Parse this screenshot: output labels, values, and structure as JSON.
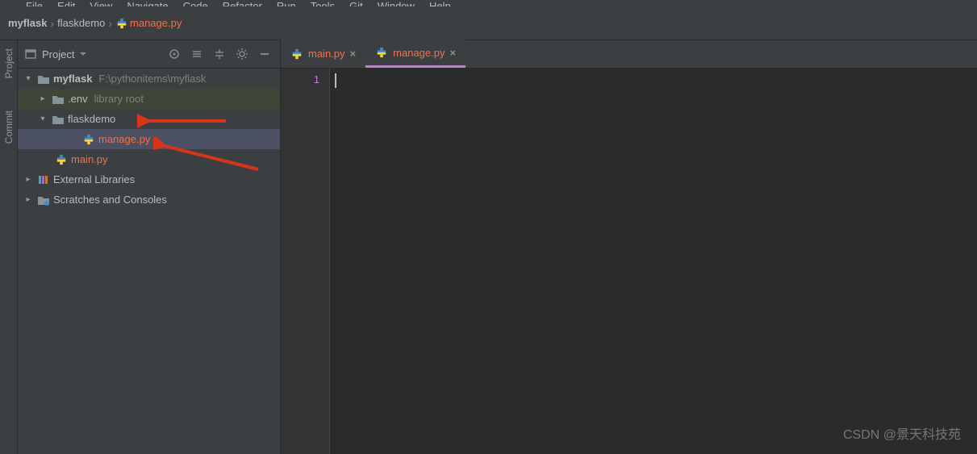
{
  "menu": [
    "File",
    "Edit",
    "View",
    "Navigate",
    "Code",
    "Refactor",
    "Run",
    "Tools",
    "Git",
    "Window",
    "Help"
  ],
  "breadcrumb": {
    "root": "myflask",
    "folder": "flaskdemo",
    "file": "manage.py"
  },
  "sidebar": {
    "title": "Project",
    "tree": {
      "root_name": "myflask",
      "root_path": "F:\\pythonitems\\myflask",
      "env_name": ".env",
      "env_tag": "library root",
      "folder1": "flaskdemo",
      "file_selected": "manage.py",
      "file_main": "main.py",
      "ext_libs": "External Libraries",
      "scratches": "Scratches and Consoles"
    }
  },
  "rail": {
    "project": "Project",
    "commit": "Commit"
  },
  "tabs": [
    {
      "label": "main.py",
      "active": false
    },
    {
      "label": "manage.py",
      "active": true
    }
  ],
  "editor": {
    "line1": "1"
  },
  "watermark": "CSDN @景天科技苑"
}
